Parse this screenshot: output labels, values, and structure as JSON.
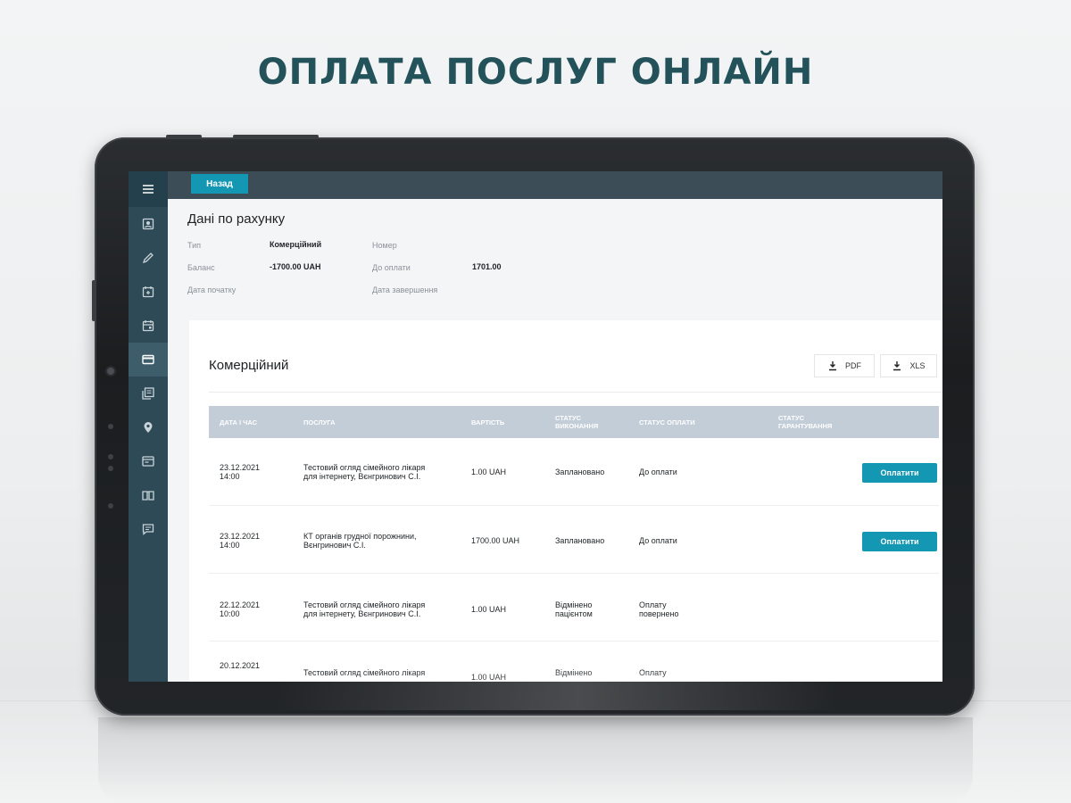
{
  "headline": "ОПЛАТА ПОСЛУГ ОНЛАЙН",
  "topbar": {
    "back_label": "Назад"
  },
  "page_title": "Дані по рахунку",
  "account": {
    "type_label": "Тип",
    "type_value": "Комерційний",
    "balance_label": "Баланс",
    "balance_value": "-1700.00 UAH",
    "start_label": "Дата початку",
    "number_label": "Номер",
    "due_label": "До оплати",
    "due_value": "1701.00",
    "end_label": "Дата завершення"
  },
  "card": {
    "title": "Комерційний",
    "pdf_label": "PDF",
    "xls_label": "XLS"
  },
  "table": {
    "headers": {
      "datetime": "Дата і час",
      "service": "Послуга",
      "cost": "Вартість",
      "exec_status_1": "Статус",
      "exec_status_2": "виконання",
      "pay_status": "Статус оплати",
      "guarantee_1": "Статус",
      "guarantee_2": "гарантування"
    },
    "rows": [
      {
        "date": "23.12.2021",
        "time": "14:00",
        "service_1": "Тестовий огляд сімейного лікаря",
        "service_2": "для інтернету, Вєнгринович С.І.",
        "cost": "1.00 UAH",
        "exec_1": "Заплановано",
        "exec_2": "",
        "pay_1": "До оплати",
        "pay_2": "",
        "action": "Оплатити"
      },
      {
        "date": "23.12.2021",
        "time": "14:00",
        "service_1": "КТ органів грудної порожнини,",
        "service_2": "Вєнгринович С.І.",
        "cost": "1700.00 UAH",
        "exec_1": "Заплановано",
        "exec_2": "",
        "pay_1": "До оплати",
        "pay_2": "",
        "action": "Оплатити"
      },
      {
        "date": "22.12.2021",
        "time": "10:00",
        "service_1": "Тестовий огляд сімейного лікаря",
        "service_2": "для інтернету, Вєнгринович С.І.",
        "cost": "1.00 UAH",
        "exec_1": "Відмінено",
        "exec_2": "пацієнтом",
        "pay_1": "Оплату",
        "pay_2": "повернено",
        "action": ""
      },
      {
        "date": "20.12.2021",
        "time": "",
        "service_1": "Тестовий огляд сімейного лікаря",
        "service_2": "",
        "cost": "1.00 UAH",
        "exec_1": "Відмінено",
        "exec_2": "",
        "pay_1": "Оплату",
        "pay_2": "",
        "action": ""
      }
    ]
  },
  "sidebar_icons": [
    "menu-icon",
    "profile-icon",
    "pencil-icon",
    "calendar-add-icon",
    "calendar-icon",
    "card-icon",
    "records-icon",
    "location-icon",
    "billing-icon",
    "book-icon",
    "chat-icon"
  ],
  "colors": {
    "accent": "#1497b3",
    "sidebar": "#2e4a57",
    "topbar": "#3c4d57",
    "headline": "#24525a",
    "table_header": "#c3cdd8"
  }
}
